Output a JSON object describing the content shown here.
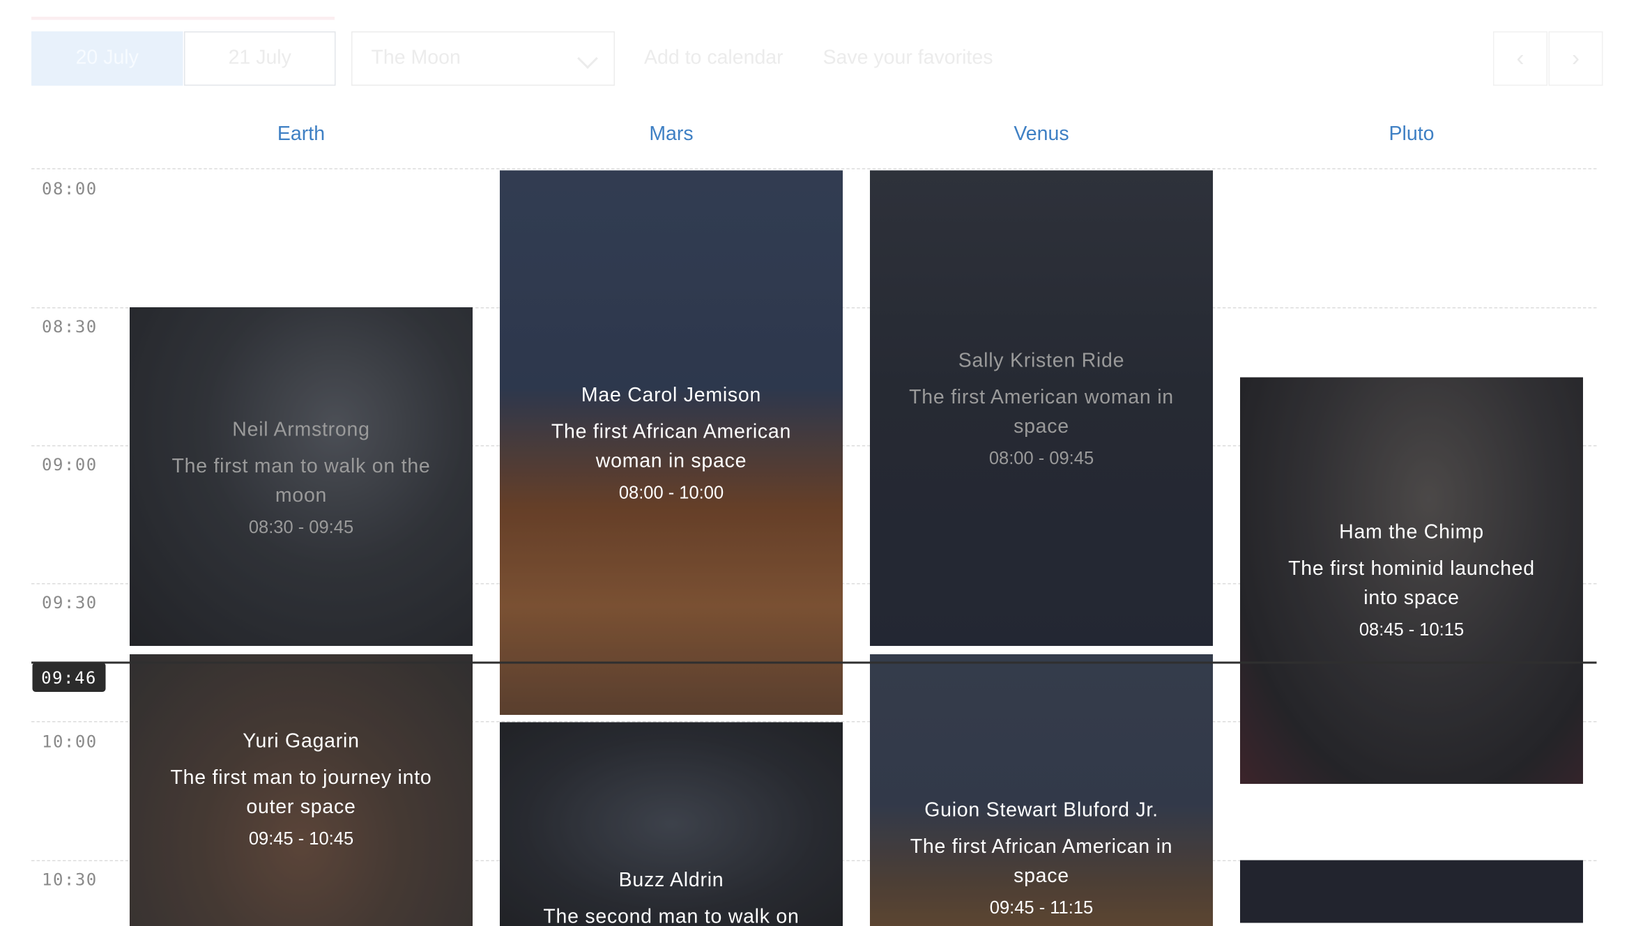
{
  "toolbar": {
    "tabs": [
      {
        "label": "20 July",
        "active": true
      },
      {
        "label": "21 July",
        "active": false
      }
    ],
    "location_select": {
      "value": "The Moon"
    },
    "add_to_calendar": "Add to calendar",
    "save_favorites": "Save your favorites",
    "prev_label": "‹",
    "next_label": "›"
  },
  "columns": [
    "Earth",
    "Mars",
    "Venus",
    "Pluto"
  ],
  "time_slots": [
    "08:00",
    "08:30",
    "09:00",
    "09:30",
    "10:00",
    "10:30"
  ],
  "current_time": "09:46",
  "events": [
    {
      "column": "Earth",
      "name": "Neil Armstrong",
      "description": "The first man to walk on the moon",
      "time": "08:30 - 09:45"
    },
    {
      "column": "Earth",
      "name": "Yuri Gagarin",
      "description": "The first man to journey into outer space",
      "time": "09:45 - 10:45"
    },
    {
      "column": "Mars",
      "name": "Mae Carol Jemison",
      "description": "The first African American woman in space",
      "time": "08:00 - 10:00"
    },
    {
      "column": "Mars",
      "name": "Buzz Aldrin",
      "description": "The second man to walk on the moon",
      "time": ""
    },
    {
      "column": "Venus",
      "name": "Sally Kristen Ride",
      "description": "The first American woman in space",
      "time": "08:00 - 09:45"
    },
    {
      "column": "Venus",
      "name": "Guion Stewart Bluford Jr.",
      "description": "The first African American in space",
      "time": "09:45 - 11:15"
    },
    {
      "column": "Pluto",
      "name": "Ham the Chimp",
      "description": "The first hominid launched into space",
      "time": "08:45 - 10:15"
    },
    {
      "column": "Pluto",
      "name": "",
      "description": "",
      "time": ""
    }
  ]
}
